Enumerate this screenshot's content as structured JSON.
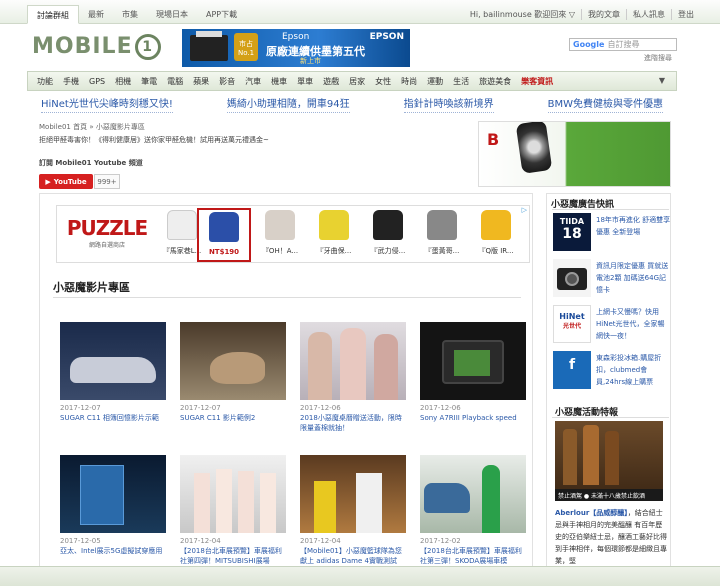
{
  "topbar": {
    "tabs": [
      "討論群組",
      "最新",
      "市集",
      "現場日本",
      "APP下載"
    ],
    "user_links": [
      "Hi, bailinmouse 歡迎回來 ▽",
      "我的文章",
      "私人訊息",
      "登出"
    ]
  },
  "header": {
    "logo_text": "MOBILE",
    "logo_digit": "1",
    "ad": {
      "brand": "Epson",
      "brand_logo": "EPSON",
      "badge": "市占 No.1",
      "headline": "原廠連續供墨第五代",
      "sub": "新上市"
    },
    "search_prefix": "Google",
    "search_placeholder": "自訂搜尋",
    "advanced_search": "進階搜尋"
  },
  "catnav": {
    "items": [
      "功能",
      "手機",
      "GPS",
      "相機",
      "筆電",
      "電腦",
      "蘋果",
      "影音",
      "汽車",
      "機車",
      "單車",
      "遊戲",
      "居家",
      "女性",
      "時尚",
      "運動",
      "生活",
      "旅遊美食"
    ],
    "hot": "樂客資訊",
    "more": "▼"
  },
  "headlines": [
    "HiNet光世代尖峰時刻穩又快!",
    "媽綺小助理相隨，開車94狂",
    "指針計時喚該新境界",
    "BMW免費健檢與零件優惠"
  ],
  "breadcrumb": "Mobile01 首頁 » 小惡魔影片專區",
  "intro": "拒絕甲醛毒害你！《得利健康居》送你家甲醛危機！試用再送萬元禮遇金~",
  "youtube": {
    "title": "訂閱 Mobile01 Youtube 頻道",
    "button": "YouTube",
    "count": "999+"
  },
  "shop_ad": {
    "brand": "PUZZLE",
    "brand_sub": "網路自選商店",
    "ad_tag": "▷",
    "items": [
      {
        "caption": "『馬家巷L...",
        "color": "#eeeeee"
      },
      {
        "caption": "NT$190",
        "color": "#2b4fa8"
      },
      {
        "caption": "『OH！A...",
        "color": "#d8d0c8"
      },
      {
        "caption": "『牙曲保...",
        "color": "#e8d230"
      },
      {
        "caption": "『武力侵...",
        "color": "#222222"
      },
      {
        "caption": "『蛋黃哥...",
        "color": "#888888"
      },
      {
        "caption": "『Q版 IR...",
        "color": "#f0b820"
      }
    ]
  },
  "section_title": "小惡魔影片專區",
  "videos": [
    {
      "date": "2017-12-07",
      "title": "SUGAR C11 相簿回憶影片示範",
      "bg": "#2a3a5a"
    },
    {
      "date": "2017-12-07",
      "title": "SUGAR C11 影片範例2",
      "bg": "#7a6a55"
    },
    {
      "date": "2017-12-06",
      "title": "2018小惡魔桌曆贈送活動，限時限量蓋棉就抽！",
      "bg": "#c8c0c8"
    },
    {
      "date": "2017-12-06",
      "title": "Sony A7RIII Playback speed",
      "bg": "#1a1a1a"
    },
    {
      "date": "2017-12-05",
      "title": "亞太、Intel展示5G虛擬試穿應用",
      "bg": "#103050"
    },
    {
      "date": "2017-12-04",
      "title": "【2018台北車展預覽】車展福利社第四彈！MITSUBISHI展場",
      "bg": "#d8d8d8"
    },
    {
      "date": "2017-12-04",
      "title": "【Mobile01】小惡魔籃球隊為您獻上 adidas Dame 4實戰測試",
      "bg": "#8a5a30"
    },
    {
      "date": "2017-12-02",
      "title": "【2018台北車展預覽】車展福利社第三彈！SKODA展場車模",
      "bg": "#c8d0c8"
    }
  ],
  "sidebar": {
    "ads_title": "小惡魔廣告快訊",
    "ads": [
      {
        "text": "18年市再進化 舒適雙享優惠 全新登場",
        "icon": "tiida-car-icon"
      },
      {
        "text": "資訊月限定優惠 買就送電池2顆 加碼送64G記憶卡",
        "icon": "camera-icon"
      },
      {
        "text": "上網卡又慢嗎？快用HiNet光世代，全家暢網快一夜！",
        "icon": "hinet-logo-icon"
      },
      {
        "text": "東森彩投冰箱.購屋折扣，clubmed會員,24hrs線上購票",
        "icon": "etmall-logo-icon"
      }
    ],
    "event_title": "小惡魔活動特報",
    "event_caption": "禁止酒駕 ● 未滿十八歲禁止飲酒",
    "event_text_bold": "Aberlour【品威醇釀】",
    "event_text": "，結合紐士忌與手神相月的完美醞釀 有百年歷史的亞伯樂紐士忌，釀酒工藝好比得到手神相伴，每個環節都是細緻且專業，堅"
  }
}
